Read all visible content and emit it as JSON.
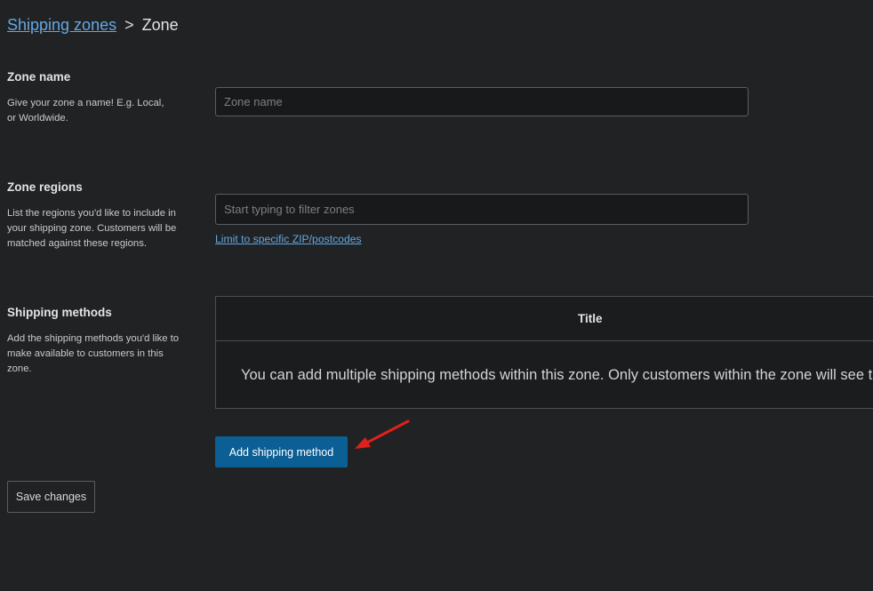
{
  "breadcrumb": {
    "parent_label": "Shipping zones",
    "separator": ">",
    "current_label": "Zone"
  },
  "zone_name": {
    "title": "Zone name",
    "description": "Give your zone a name! E.g. Local, or Worldwide.",
    "input_value": "",
    "placeholder": "Zone name"
  },
  "zone_regions": {
    "title": "Zone regions",
    "description": "List the regions you'd like to include in your shipping zone. Customers will be matched against these regions.",
    "input_value": "",
    "placeholder": "Start typing to filter zones",
    "limit_link": "Limit to specific ZIP/postcodes"
  },
  "shipping_methods": {
    "title": "Shipping methods",
    "description": "Add the shipping methods you'd like to make available to customers in this zone.",
    "table": {
      "columns": [
        "Title"
      ],
      "empty_message": "You can add multiple shipping methods within this zone. Only customers within the zone will see them."
    },
    "add_button": "Add shipping method"
  },
  "footer": {
    "save_button": "Save changes"
  },
  "colors": {
    "background": "#202224",
    "link": "#63a8e4",
    "primary_button": "#0b5f95",
    "annotation_arrow": "#e0201c"
  },
  "icons": {
    "annotation": "red-arrow-icon"
  }
}
